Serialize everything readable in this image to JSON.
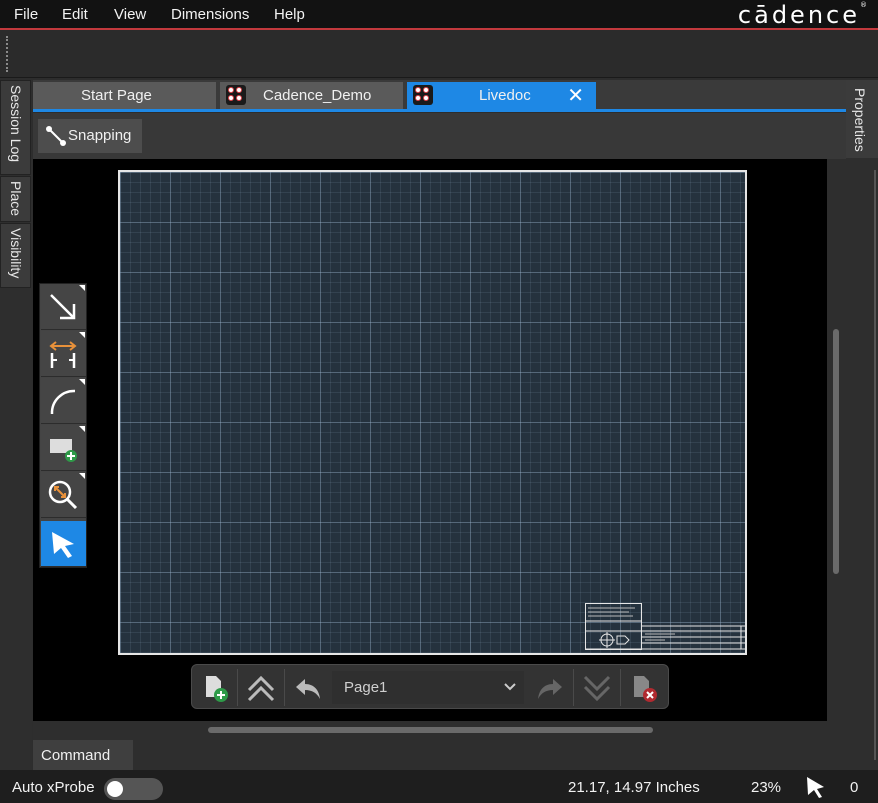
{
  "menubar": {
    "items": [
      "File",
      "Edit",
      "View",
      "Dimensions",
      "Help"
    ],
    "brand": "cādence"
  },
  "left_panels": [
    "Session Log",
    "Place",
    "Visibility"
  ],
  "right_panels": [
    "Properties"
  ],
  "tabs": [
    {
      "label": "Start Page",
      "active": false,
      "icon": null
    },
    {
      "label": "Cadence_Demo",
      "active": false,
      "icon": "cadence-doc-icon"
    },
    {
      "label": "Livedoc",
      "active": true,
      "icon": "cadence-doc-icon",
      "closable": true
    }
  ],
  "snapbar": {
    "snapping_label": "Snapping",
    "icon": "snap-line-icon"
  },
  "toolbox": [
    {
      "name": "wire-tool",
      "icon": "diagonal-arrow-icon",
      "active": false
    },
    {
      "name": "dimension-tool",
      "icon": "dimension-icon",
      "active": false
    },
    {
      "name": "arc-tool",
      "icon": "arc-icon",
      "active": false
    },
    {
      "name": "add-shape-tool",
      "icon": "add-rectangle-icon",
      "active": false
    },
    {
      "name": "zoom-tool",
      "icon": "zoom-icon",
      "active": false
    },
    {
      "name": "select-tool",
      "icon": "pointer-arrow-icon",
      "active": true
    }
  ],
  "page_nav": {
    "add_page": "add-page-icon",
    "first_page": "double-chevron-up-icon",
    "prev_page": "undo-arrow-icon",
    "current_page": "Page1",
    "next_page": "redo-arrow-icon",
    "last_page": "double-chevron-down-icon",
    "delete_page": "delete-page-icon"
  },
  "command": {
    "label": "Command"
  },
  "statusbar": {
    "auto_xprobe_label": "Auto xProbe",
    "auto_xprobe_on": false,
    "coordinates": "21.17, 14.97 Inches",
    "zoom": "23%",
    "count": "0"
  },
  "colors": {
    "accent": "#1e88e5",
    "menubar_line": "#c2393d",
    "sheet_bg": "#25323e"
  }
}
